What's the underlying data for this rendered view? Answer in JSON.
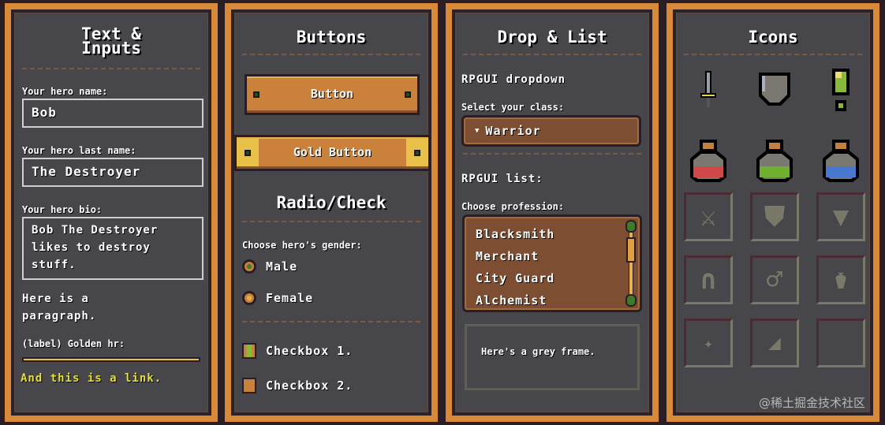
{
  "text_inputs": {
    "title_line1": "Text &",
    "title_line2": "Inputs",
    "name_label": "Your hero name:",
    "name_value": "Bob",
    "last_label": "Your hero last name:",
    "last_value": "The Destroyer",
    "bio_label": "Your hero bio:",
    "bio_value": "Bob The Destroyer likes to destroy stuff.",
    "paragraph": "Here is a paragraph.",
    "golden_label": "(label) Golden hr:",
    "link": "And this is a link."
  },
  "buttons": {
    "title": "Buttons",
    "button": "Button",
    "gold_button": "Gold Button",
    "radio_title": "Radio/Check",
    "gender_label": "Choose hero's gender:",
    "radios": [
      {
        "label": "Male",
        "checked": true
      },
      {
        "label": "Female",
        "checked": false
      }
    ],
    "checkboxes": [
      {
        "label": "Checkbox 1.",
        "checked": true
      },
      {
        "label": "Checkbox 2.",
        "checked": false
      }
    ]
  },
  "drop_list": {
    "title": "Drop & List",
    "dropdown_heading": "RPGUI dropdown",
    "select_label": "Select your class:",
    "selected": "Warrior",
    "list_heading": "RPGUI list:",
    "list_label": "Choose profession:",
    "list_items": [
      "Blacksmith",
      "Merchant",
      "City Guard",
      "Alchemist"
    ],
    "frame_text": "Here's a grey frame."
  },
  "icons": {
    "title": "Icons",
    "items": [
      "sword-icon",
      "shield-icon",
      "exclamation-icon",
      "red-potion-icon",
      "green-potion-icon",
      "blue-potion-icon"
    ],
    "slots": [
      "weapon-slot-icon",
      "shield-slot-icon",
      "armor-slot-icon",
      "helmet-slot-icon",
      "ring-slot-icon",
      "potion-slot-icon",
      "magic-slot-icon",
      "shoes-slot-icon",
      "empty-slot"
    ]
  },
  "watermark": "@稀土掘金技术社区",
  "colors": {
    "wood": "#c9813c",
    "panel": "#47464b",
    "link": "#e5e033"
  }
}
